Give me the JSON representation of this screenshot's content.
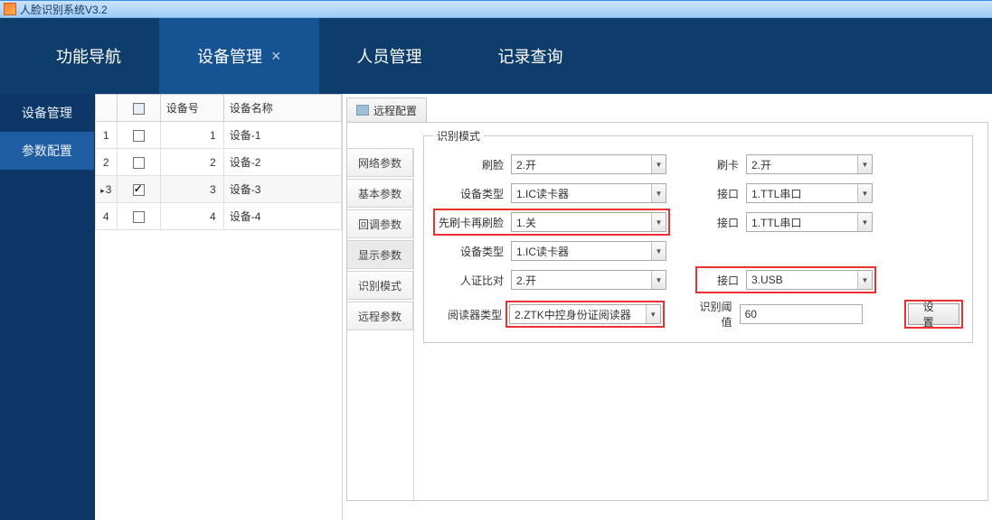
{
  "titlebar": {
    "title": "人脸识别系统V3.2"
  },
  "maintabs": [
    {
      "label": "功能导航",
      "active": false,
      "closable": false
    },
    {
      "label": "设备管理",
      "active": true,
      "closable": true
    },
    {
      "label": "人员管理",
      "active": false,
      "closable": false
    },
    {
      "label": "记录查询",
      "active": false,
      "closable": false
    }
  ],
  "sidebar": [
    {
      "label": "设备管理",
      "active": false
    },
    {
      "label": "参数配置",
      "active": true
    }
  ],
  "table": {
    "headers": {
      "num": "设备号",
      "name": "设备名称"
    },
    "rows": [
      {
        "idx": "1",
        "checked": false,
        "num": "1",
        "name": "设备-1",
        "selected": false
      },
      {
        "idx": "2",
        "checked": false,
        "num": "2",
        "name": "设备-2",
        "selected": false
      },
      {
        "idx": "3",
        "checked": true,
        "num": "3",
        "name": "设备-3",
        "selected": true
      },
      {
        "idx": "4",
        "checked": false,
        "num": "4",
        "name": "设备-4",
        "selected": false
      }
    ]
  },
  "subtab": {
    "label": "远程配置"
  },
  "param_nav": [
    {
      "label": "网络参数",
      "active": false
    },
    {
      "label": "基本参数",
      "active": false
    },
    {
      "label": "回调参数",
      "active": false
    },
    {
      "label": "显示参数",
      "active": true
    },
    {
      "label": "识别模式",
      "active": false
    },
    {
      "label": "远程参数",
      "active": false
    }
  ],
  "fieldset": {
    "legend": "识别模式"
  },
  "form": {
    "left_labels": {
      "row1": "刷脸",
      "row2": "设备类型",
      "row3": "先刷卡再刷脸",
      "row4": "设备类型",
      "row5": "人证比对",
      "row6": "阅读器类型"
    },
    "left_values": {
      "row1": "2.开",
      "row2": "1.IC读卡器",
      "row3": "1.关",
      "row4": "1.IC读卡器",
      "row5": "2.开",
      "row6": "2.ZTK中控身份证阅读器"
    },
    "right_labels": {
      "row1": "刷卡",
      "row2": "接口",
      "row3": "接口",
      "row5": "接口",
      "row6": "识别阈值"
    },
    "right_values": {
      "row1": "2.开",
      "row2": "1.TTL串口",
      "row3": "1.TTL串口",
      "row5": "3.USB",
      "row6": "60"
    },
    "button": "设置"
  }
}
